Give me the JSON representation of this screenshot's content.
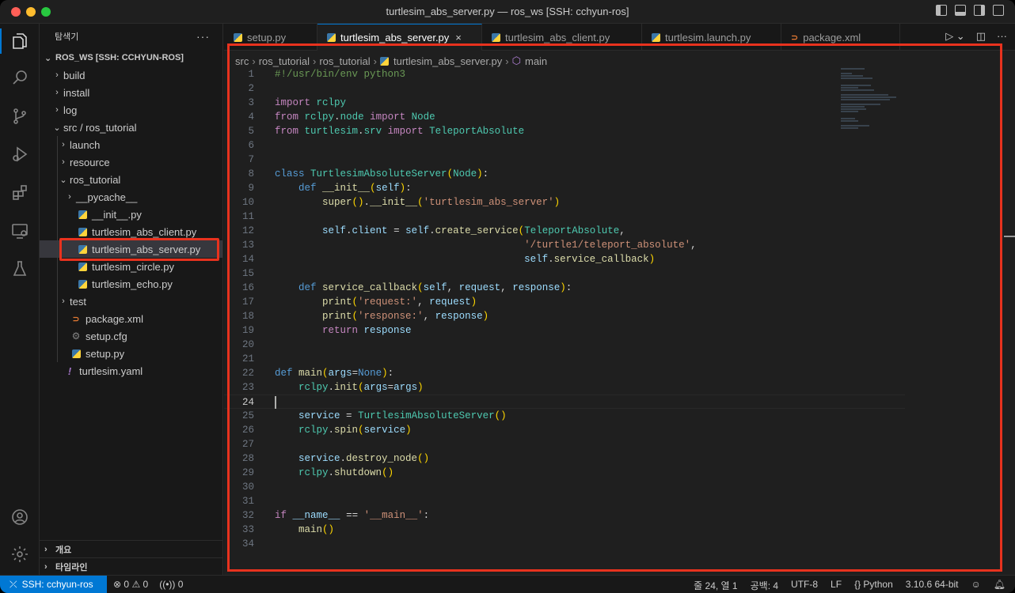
{
  "window": {
    "title": "turtlesim_abs_server.py — ros_ws [SSH: cchyun-ros]"
  },
  "sidebar": {
    "header": "탐색기",
    "more": "···",
    "root": "ROS_WS [SSH: CCHYUN-ROS]",
    "items": [
      {
        "label": "build",
        "chev": "›",
        "depth": 1,
        "kind": "folder"
      },
      {
        "label": "install",
        "chev": "›",
        "depth": 1,
        "kind": "folder"
      },
      {
        "label": "log",
        "chev": "›",
        "depth": 1,
        "kind": "folder"
      },
      {
        "label": "src / ros_tutorial",
        "chev": "⌄",
        "depth": 1,
        "kind": "folder"
      },
      {
        "label": "launch",
        "chev": "›",
        "depth": 2,
        "kind": "folder"
      },
      {
        "label": "resource",
        "chev": "›",
        "depth": 2,
        "kind": "folder"
      },
      {
        "label": "ros_tutorial",
        "chev": "⌄",
        "depth": 2,
        "kind": "folder"
      },
      {
        "label": "__pycache__",
        "chev": "›",
        "depth": 3,
        "kind": "folder"
      },
      {
        "label": "__init__.py",
        "chev": "",
        "depth": 3,
        "kind": "py"
      },
      {
        "label": "turtlesim_abs_client.py",
        "chev": "",
        "depth": 3,
        "kind": "py"
      },
      {
        "label": "turtlesim_abs_server.py",
        "chev": "",
        "depth": 3,
        "kind": "py"
      },
      {
        "label": "turtlesim_circle.py",
        "chev": "",
        "depth": 3,
        "kind": "py"
      },
      {
        "label": "turtlesim_echo.py",
        "chev": "",
        "depth": 3,
        "kind": "py"
      },
      {
        "label": "test",
        "chev": "›",
        "depth": 2,
        "kind": "folder"
      },
      {
        "label": "package.xml",
        "chev": "",
        "depth": 2,
        "kind": "xml"
      },
      {
        "label": "setup.cfg",
        "chev": "",
        "depth": 2,
        "kind": "cfg"
      },
      {
        "label": "setup.py",
        "chev": "",
        "depth": 2,
        "kind": "py"
      },
      {
        "label": "turtlesim.yaml",
        "chev": "",
        "depth": 1,
        "kind": "yaml"
      }
    ],
    "outline": "개요",
    "timeline": "타임라인"
  },
  "tabs": [
    {
      "label": "setup.py",
      "icon": "python-icon"
    },
    {
      "label": "turtlesim_abs_server.py",
      "icon": "python-icon",
      "close": "×"
    },
    {
      "label": "turtlesim_abs_client.py",
      "icon": "python-icon"
    },
    {
      "label": "turtlesim.launch.py",
      "icon": "python-icon"
    },
    {
      "label": "package.xml",
      "icon": "xml-icon"
    }
  ],
  "breadcrumbs": [
    "src",
    "ros_tutorial",
    "ros_tutorial",
    "turtlesim_abs_server.py",
    "main"
  ],
  "editor": {
    "line_numbers": [
      "1",
      "2",
      "3",
      "4",
      "5",
      "6",
      "7",
      "8",
      "9",
      "10",
      "11",
      "12",
      "13",
      "14",
      "15",
      "16",
      "17",
      "18",
      "19",
      "20",
      "21",
      "22",
      "23",
      "24",
      "25",
      "26",
      "27",
      "28",
      "29",
      "30",
      "31",
      "32",
      "33",
      "34"
    ],
    "current_line": 24
  },
  "statusbar": {
    "remote": "SSH: cchyun-ros",
    "errors": "0",
    "warnings": "0",
    "ports": "0",
    "position": "줄 24, 열 1",
    "spaces": "공백: 4",
    "encoding": "UTF-8",
    "eol": "LF",
    "language": "Python",
    "interpreter": "3.10.6 64-bit"
  },
  "colors": {
    "accent": "#0078d4",
    "highlight_box": "#e8321e",
    "keyword": "#c586c0",
    "class": "#4ec9b0",
    "function": "#dcdcaa",
    "string": "#ce9178",
    "parameter": "#9cdcfe",
    "comment": "#6a9955"
  }
}
